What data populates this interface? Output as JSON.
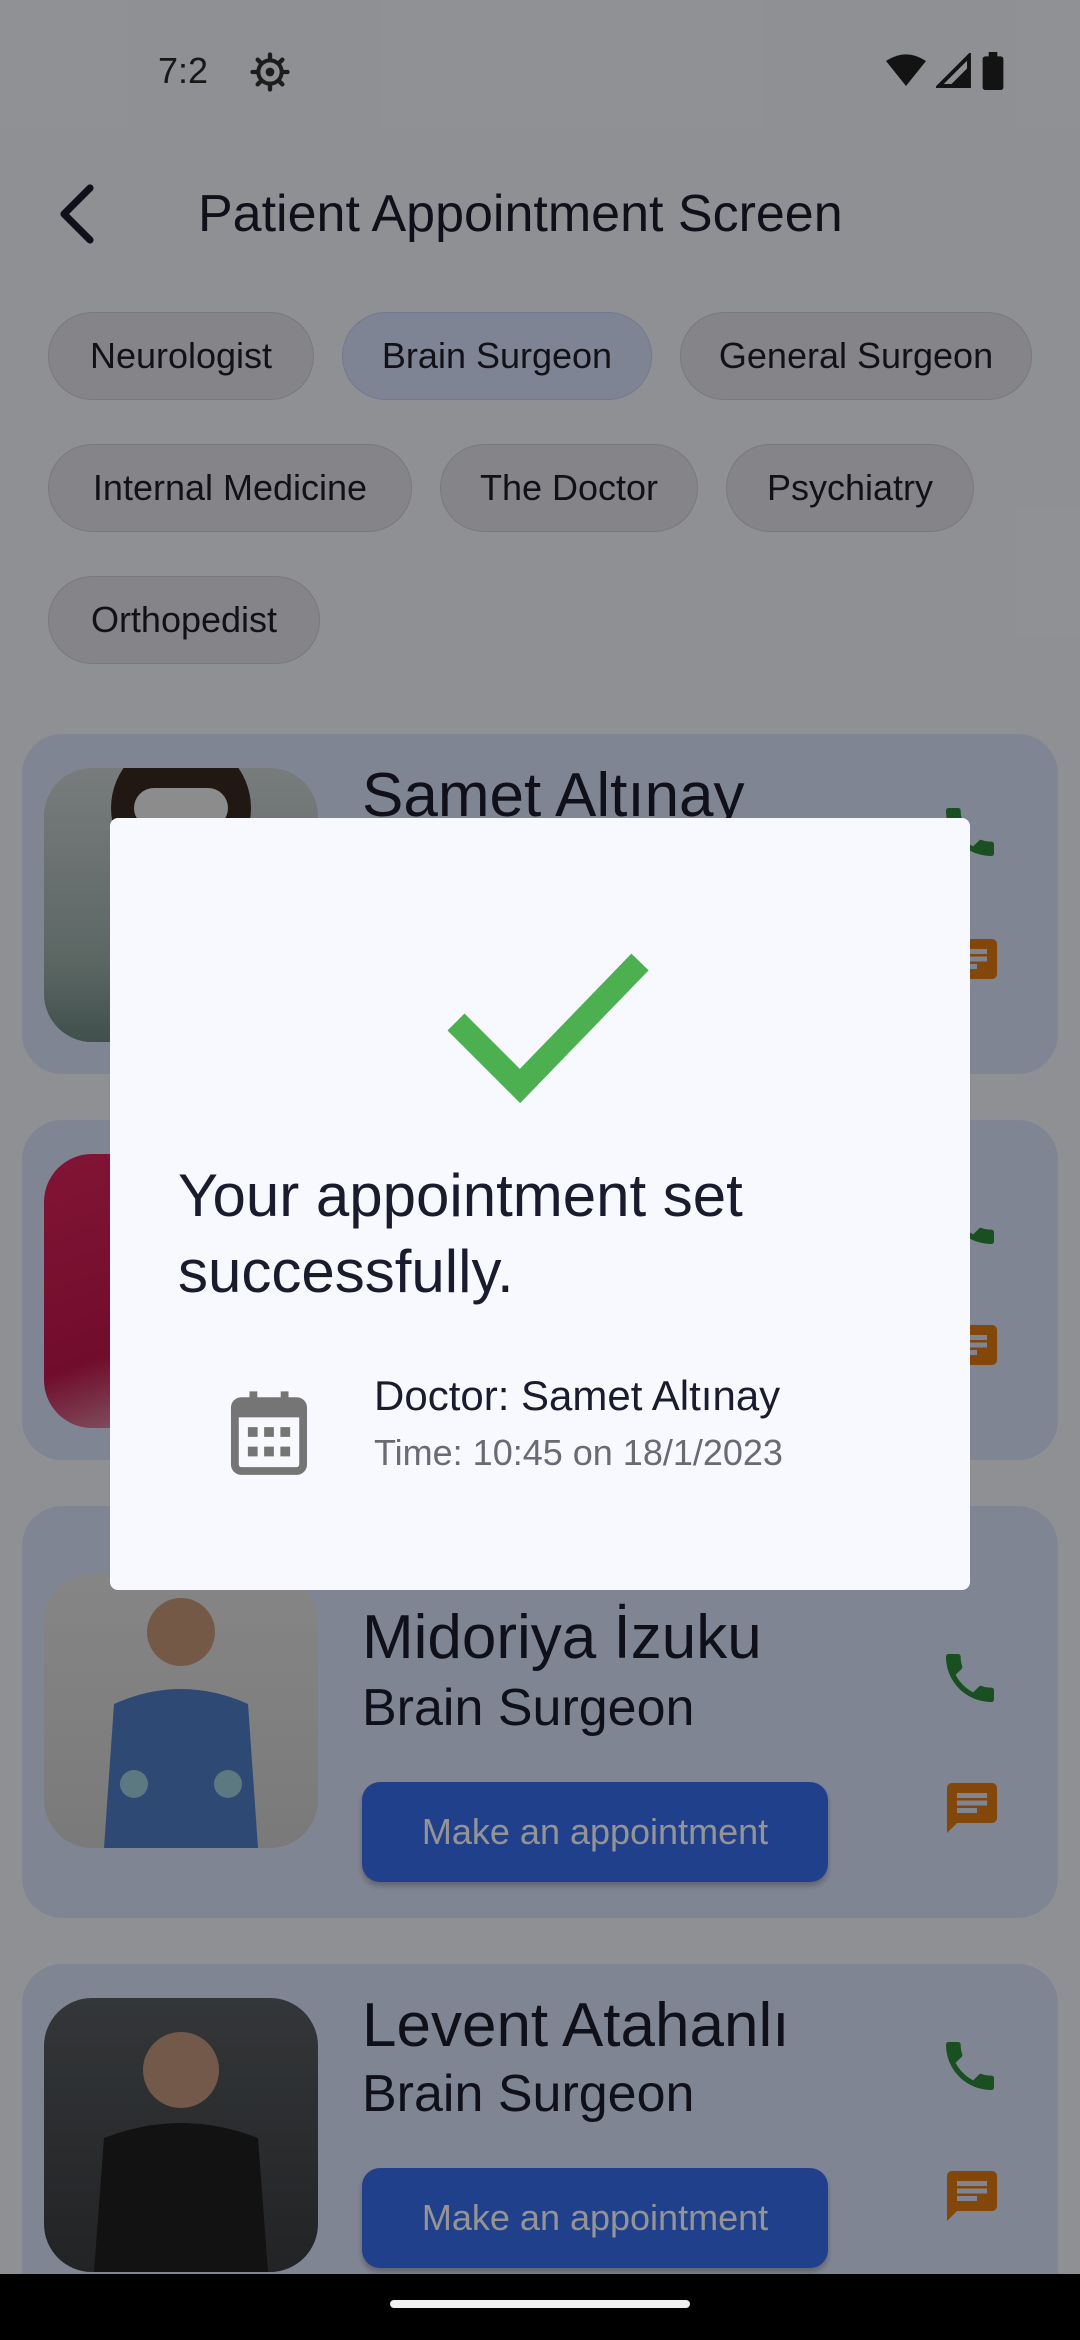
{
  "status_bar": {
    "time": "7:2"
  },
  "app_bar": {
    "title": "Patient Appointment Screen"
  },
  "filters": [
    {
      "label": "Neurologist",
      "selected": false
    },
    {
      "label": "Brain Surgeon",
      "selected": true
    },
    {
      "label": "General Surgeon",
      "selected": false
    },
    {
      "label": "Internal Medicine",
      "selected": false
    },
    {
      "label": "The Doctor",
      "selected": false
    },
    {
      "label": "Psychiatry",
      "selected": false
    },
    {
      "label": "Orthopedist",
      "selected": false
    }
  ],
  "doctors": [
    {
      "name": "Samet Altınay",
      "specialty": "",
      "button": ""
    },
    {
      "name": "",
      "specialty": "",
      "button": ""
    },
    {
      "name": "Midoriya İzuku",
      "specialty": "Brain Surgeon",
      "button": "Make an appointment"
    },
    {
      "name": "Levent Atahanlı",
      "specialty": "Brain Surgeon",
      "button": "Make an appointment"
    }
  ],
  "dialog": {
    "message": "Your appointment set successfully.",
    "doctor": "Doctor: Samet Altınay",
    "time": "Time: 10:45 on 18/1/2023"
  },
  "colors": {
    "accent": "#3a6ef0",
    "card_bg": "#dde6ff",
    "phone": "#2e8b3a",
    "message": "#e07a10",
    "check": "#4caf50"
  }
}
